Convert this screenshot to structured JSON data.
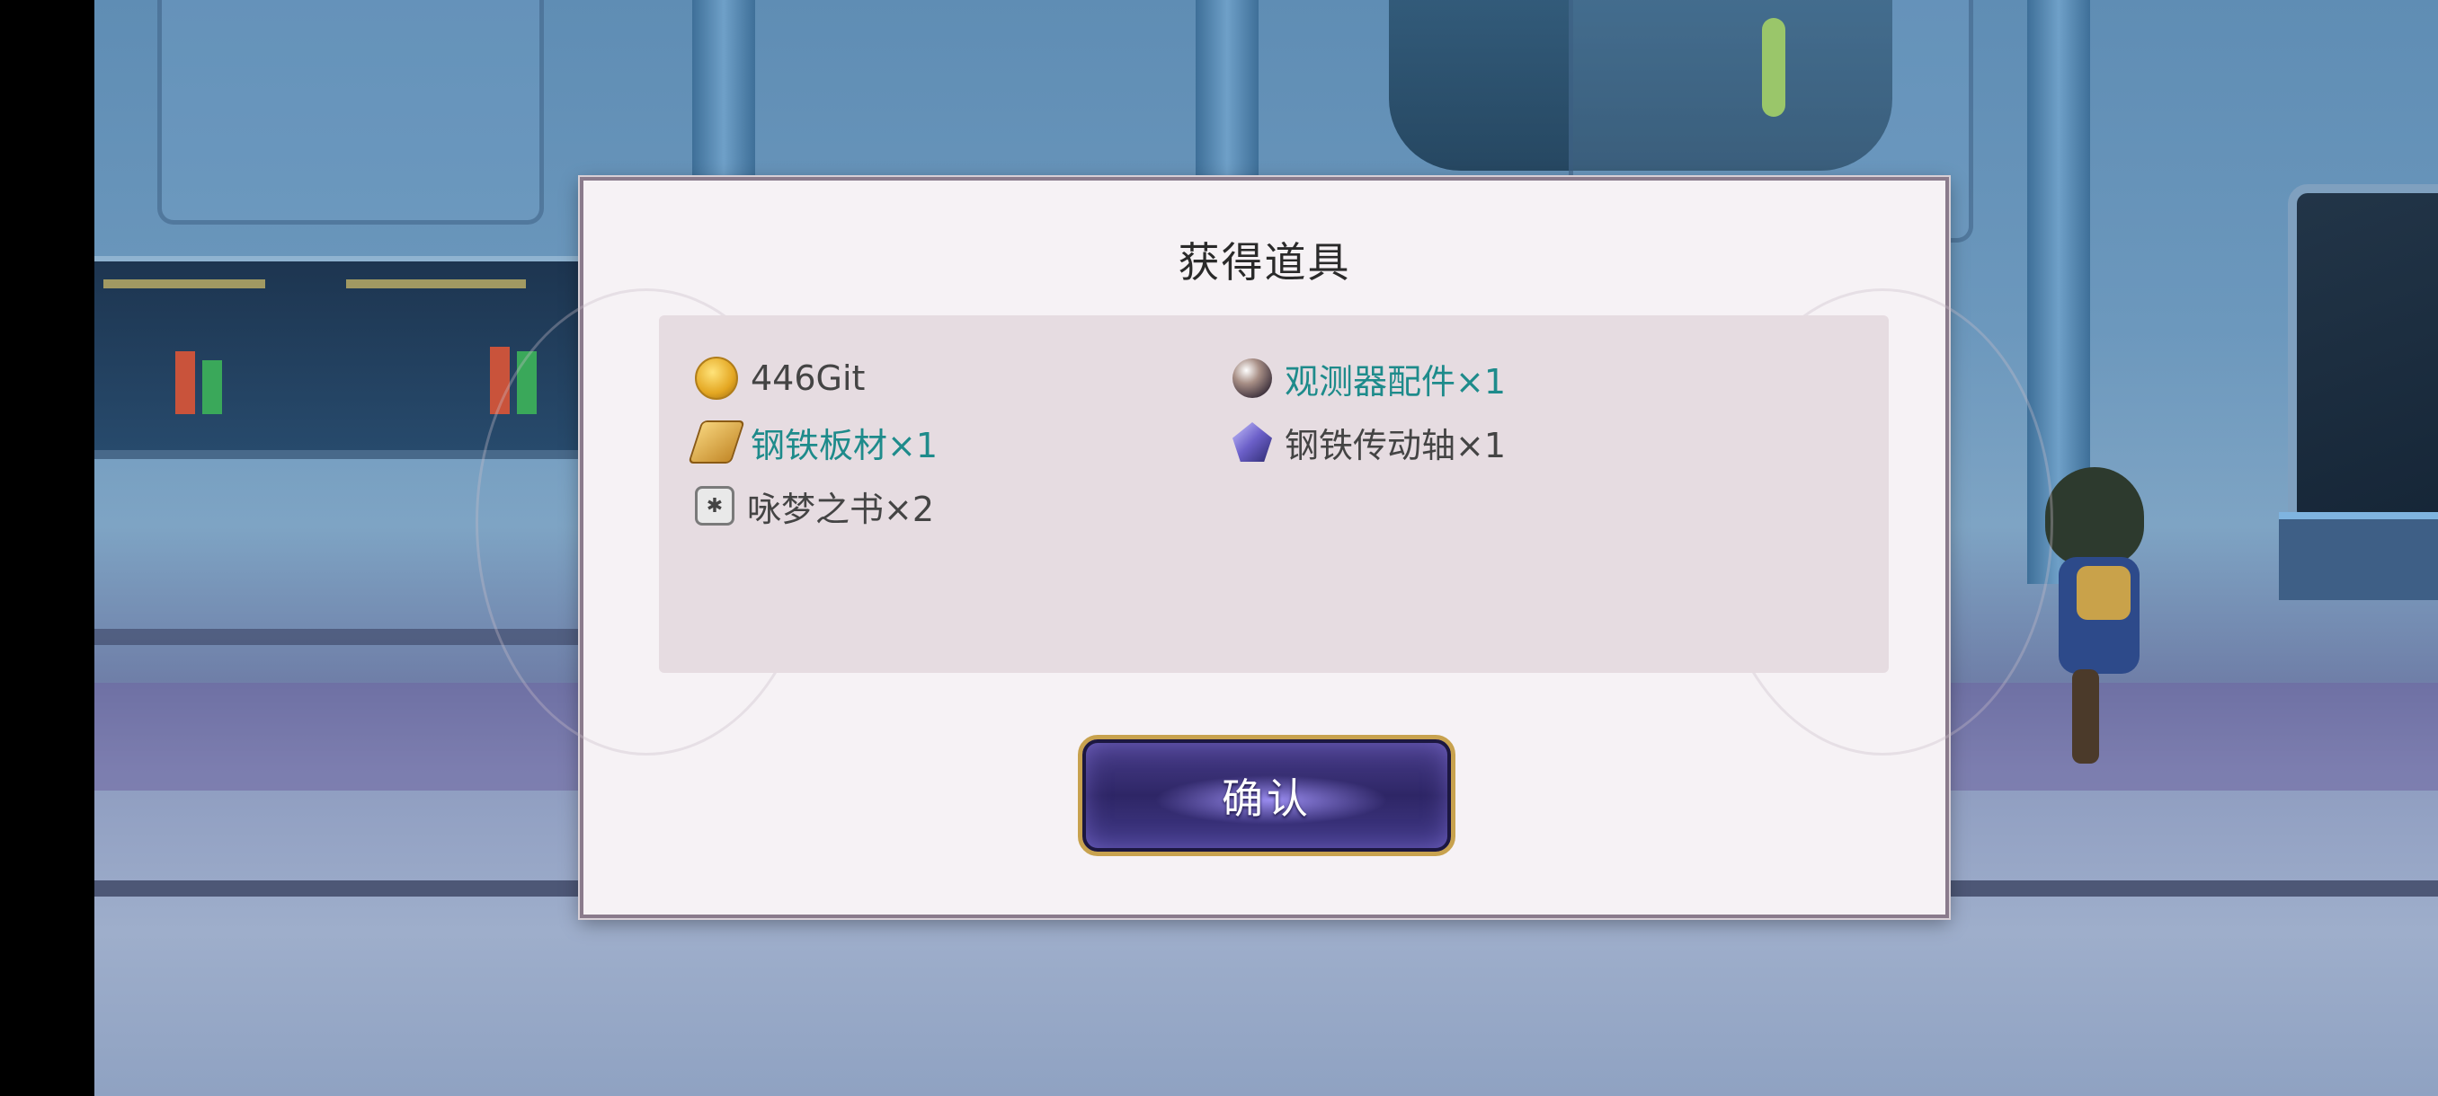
{
  "dialog": {
    "title": "获得道具",
    "items": [
      {
        "icon": "coin-icon",
        "text": "446Git",
        "highlight": false
      },
      {
        "icon": "orb-icon",
        "text": "观测器配件×1",
        "highlight": true
      },
      {
        "icon": "steel-plate-icon",
        "text": "钢铁板材×1",
        "highlight": true
      },
      {
        "icon": "crystal-icon",
        "text": "钢铁传动轴×1",
        "highlight": false
      },
      {
        "icon": "book-icon",
        "text": "咏梦之书×2",
        "highlight": false
      }
    ],
    "confirm_label": "确认"
  },
  "colors": {
    "highlight_text": "#1e8b8b",
    "normal_text": "#444444",
    "button_border": "#c8a24e",
    "button_fill": "#2e2666"
  }
}
